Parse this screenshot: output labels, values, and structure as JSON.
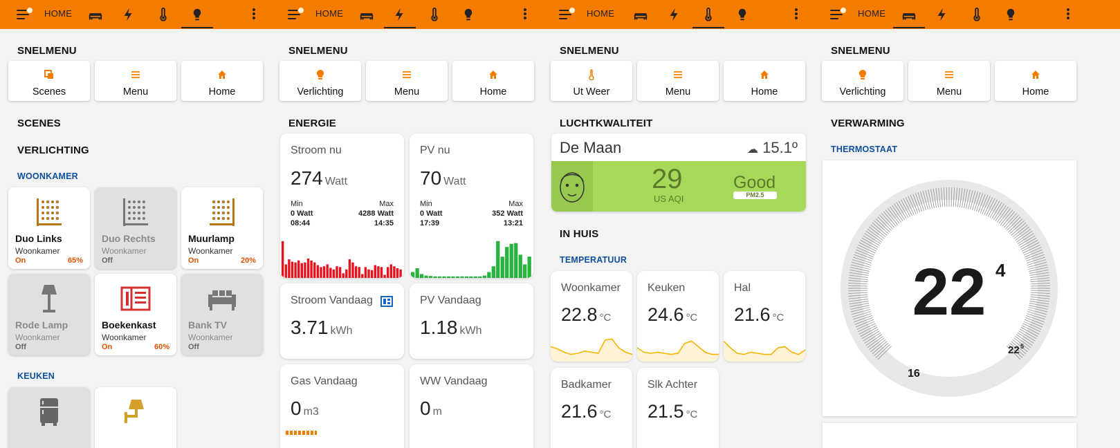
{
  "colors": {
    "accent": "#f57c00",
    "header_blue": "#0d4f9c",
    "on_orange": "#e65100",
    "good_green": "#a6d95a",
    "tile_orange": "#b8731b",
    "power_red": "#e8111c",
    "pv_green": "#27b33e"
  },
  "panels": [
    {
      "header": {
        "home": "HOME",
        "active": "lighting"
      },
      "snelmenu": "SNELMENU",
      "quick": [
        {
          "label": "Scenes",
          "icon": "scenes-icon"
        },
        {
          "label": "Menu",
          "icon": "menu-icon"
        },
        {
          "label": "Home",
          "icon": "home-icon"
        }
      ],
      "scenes": "SCENES",
      "verlichting": "VERLICHTING",
      "woonkamer": "WOONKAMER",
      "keuken": "KEUKEN",
      "tiles": [
        {
          "name": "Duo Links",
          "room": "Woonkamer",
          "state": "On",
          "pct": "65%",
          "on": true,
          "icon": "light-grid-icon"
        },
        {
          "name": "Duo Rechts",
          "room": "Woonkamer",
          "state": "Off",
          "pct": "",
          "on": false,
          "icon": "light-grid-icon"
        },
        {
          "name": "Muurlamp",
          "room": "Woonkamer",
          "state": "On",
          "pct": "20%",
          "on": true,
          "icon": "light-grid-icon"
        },
        {
          "name": "Rode Lamp",
          "room": "Woonkamer",
          "state": "Off",
          "pct": "",
          "on": false,
          "icon": "floor-lamp-icon"
        },
        {
          "name": "Boekenkast",
          "room": "Woonkamer",
          "state": "On",
          "pct": "60%",
          "on": true,
          "icon": "bookshelf-icon"
        },
        {
          "name": "Bank TV",
          "room": "Woonkamer",
          "state": "Off",
          "pct": "",
          "on": false,
          "icon": "sofa-icon"
        }
      ]
    },
    {
      "header": {
        "home": "HOME",
        "active": "energy"
      },
      "snelmenu": "SNELMENU",
      "quick": [
        {
          "label": "Verlichting",
          "icon": "bulb-icon"
        },
        {
          "label": "Menu",
          "icon": "menu-icon"
        },
        {
          "label": "Home",
          "icon": "home-icon"
        }
      ],
      "energie": "ENERGIE",
      "stroom": {
        "name": "Stroom nu",
        "value": "274",
        "unit": "Watt",
        "min_label": "Min",
        "max_label": "Max",
        "min": "0 Watt",
        "max": "4288 Watt",
        "min_time": "08:44",
        "max_time": "14:35",
        "bars": [
          0.95,
          0.35,
          0.48,
          0.42,
          0.4,
          0.45,
          0.38,
          0.4,
          0.5,
          0.45,
          0.4,
          0.33,
          0.28,
          0.3,
          0.35,
          0.26,
          0.22,
          0.3,
          0.28,
          0.12,
          0.22,
          0.48,
          0.4,
          0.3,
          0.28,
          0.1,
          0.28,
          0.22,
          0.2,
          0.33,
          0.3,
          0.28,
          0.08,
          0.28,
          0.35,
          0.3,
          0.25,
          0.22
        ]
      },
      "pv": {
        "name": "PV nu",
        "value": "70",
        "unit": "Watt",
        "min_label": "Min",
        "max_label": "Max",
        "min": "0 Watt",
        "max": "352 Watt",
        "min_time": "17:39",
        "max_time": "13:21",
        "bars": [
          0.15,
          0.25,
          0.1,
          0.06,
          0.05,
          0.04,
          0.04,
          0.04,
          0.04,
          0.04,
          0.04,
          0.04,
          0.04,
          0.04,
          0.04,
          0.04,
          0.06,
          0.15,
          0.3,
          0.95,
          0.55,
          0.8,
          0.88,
          0.9,
          0.6,
          0.35,
          0.55
        ]
      },
      "stroom_vandaag": {
        "name": "Stroom Vandaag",
        "value": "3.71",
        "unit": "kWh"
      },
      "pv_vandaag": {
        "name": "PV Vandaag",
        "value": "1.18",
        "unit": "kWh"
      },
      "gas_vandaag": {
        "name": "Gas Vandaag",
        "value": "0",
        "unit": "m3"
      },
      "ww_vandaag": {
        "name": "WW Vandaag",
        "value": "0",
        "unit": "m"
      }
    },
    {
      "header": {
        "home": "HOME",
        "active": "climate"
      },
      "snelmenu": "SNELMENU",
      "quick": [
        {
          "label": "Ut Weer",
          "icon": "thermometer-icon"
        },
        {
          "label": "Menu",
          "icon": "menu-icon"
        },
        {
          "label": "Home",
          "icon": "home-icon"
        }
      ],
      "lucht": "LUCHTKWALITEIT",
      "aq": {
        "location": "De Maan",
        "weather": "15.1º",
        "aqi": "29",
        "aqi_unit": "US AQI",
        "status": "Good",
        "pollutant": "PM2.5"
      },
      "inhuis": "IN HUIS",
      "temperatuur": "TEMPERATUUR",
      "temps": [
        {
          "name": "Woonkamer",
          "value": "22.8",
          "unit": "°C",
          "spark": [
            0.55,
            0.45,
            0.3,
            0.2,
            0.25,
            0.35,
            0.3,
            0.25,
            0.85,
            0.9,
            0.5,
            0.3,
            0.2
          ]
        },
        {
          "name": "Keuken",
          "value": "24.6",
          "unit": "°C",
          "spark": [
            0.5,
            0.3,
            0.25,
            0.3,
            0.25,
            0.2,
            0.25,
            0.7,
            0.8,
            0.55,
            0.3,
            0.2,
            0.2
          ]
        },
        {
          "name": "Hal",
          "value": "21.6",
          "unit": "°C",
          "spark": [
            0.8,
            0.5,
            0.25,
            0.2,
            0.3,
            0.25,
            0.2,
            0.2,
            0.5,
            0.55,
            0.3,
            0.2,
            0.4
          ]
        },
        {
          "name": "Badkamer",
          "value": "21.6",
          "unit": "°C",
          "spark": []
        },
        {
          "name": "Slk Achter",
          "value": "21.5",
          "unit": "°C",
          "spark": []
        }
      ]
    },
    {
      "header": {
        "home": "HOME",
        "active": "heating"
      },
      "snelmenu": "SNELMENU",
      "quick": [
        {
          "label": "Verlichting",
          "icon": "bulb-icon"
        },
        {
          "label": "Menu",
          "icon": "menu-icon"
        },
        {
          "label": "Home",
          "icon": "home-icon"
        }
      ],
      "verwarming": "VERWARMING",
      "thermostaat": "THERMOSTAAT",
      "thermo": {
        "current": "22",
        "current_decimal": "4",
        "target": "22",
        "target_decimal": "5",
        "min_label": "16"
      }
    }
  ]
}
